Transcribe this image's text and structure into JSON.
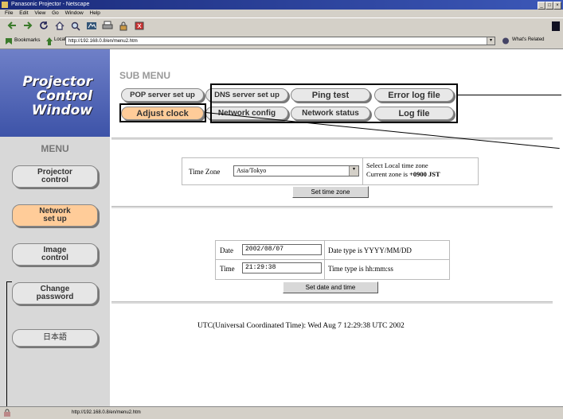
{
  "window": {
    "title": "Panasonic Projector - Netscape",
    "menus": [
      "File",
      "Edit",
      "View",
      "Go",
      "Window",
      "Help"
    ],
    "location_label": "Location:",
    "url": "http://192.168.0.8/en/menu2.htm",
    "bookmarks_label": "Bookmarks",
    "whats_related": "What's Related",
    "status_url": "http://192.168.0.8/en/menu2.htm"
  },
  "brand": {
    "line1": "Projector",
    "line2": "Control",
    "line3": "Window"
  },
  "sidebar": {
    "menu_title": "MENU",
    "items": [
      {
        "line1": "Projector",
        "line2": "control"
      },
      {
        "line1": "Network",
        "line2": "set up"
      },
      {
        "line1": "Image",
        "line2": "control"
      },
      {
        "line1": "Change",
        "line2": "password"
      },
      {
        "line1": "日本語",
        "line2": ""
      }
    ]
  },
  "submenu": {
    "title": "SUB MENU",
    "row1": [
      "POP server set up",
      "DNS server set up",
      "Ping test",
      "Error log file"
    ],
    "row2": [
      "Adjust clock",
      "Network config",
      "Network status",
      "Log file"
    ]
  },
  "timezone": {
    "label": "Time Zone",
    "value": "Asia/Tokyo",
    "hint1": "Select Local time zone",
    "hint2_prefix": "Current zone is",
    "hint2_value": "+0900 JST",
    "button": "Set time zone"
  },
  "datetime": {
    "date_label": "Date",
    "date_value": "2002/08/07",
    "date_hint": "Date type is YYYY/MM/DD",
    "time_label": "Time",
    "time_value": "21:29:38",
    "time_hint": "Time type is hh:mm:ss",
    "button": "Set date and time"
  },
  "utc_text": "UTC(Universal Coordinated Time): Wed Aug 7 12:29:38 UTC 2002",
  "colors": {
    "active_button": "#ffcc99",
    "brand_blue": "#3d53a8"
  }
}
